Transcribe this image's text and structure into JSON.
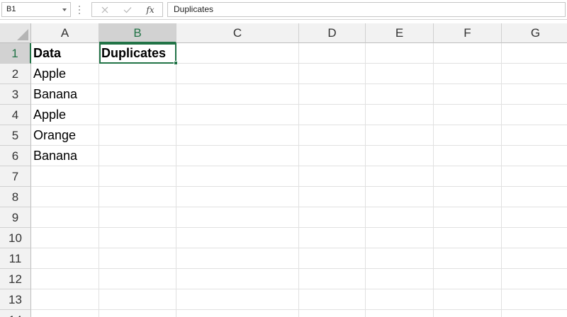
{
  "formula_bar": {
    "name_box": "B1",
    "content": "Duplicates",
    "fx_label": "fx"
  },
  "columns": [
    "A",
    "B",
    "C",
    "D",
    "E",
    "F",
    "G"
  ],
  "selected_column": "B",
  "rows": [
    "1",
    "2",
    "3",
    "4",
    "5",
    "6",
    "7",
    "8",
    "9",
    "10",
    "11",
    "12",
    "13",
    "14"
  ],
  "selected_row": "1",
  "sheet": {
    "A1": "Data",
    "B1": "Duplicates",
    "A2": "Apple",
    "A3": "Banana",
    "A4": "Apple",
    "A5": "Orange",
    "A6": "Banana"
  },
  "bold_cells": [
    "A1",
    "B1"
  ],
  "active_cell": "B1",
  "colors": {
    "accent": "#217346"
  }
}
